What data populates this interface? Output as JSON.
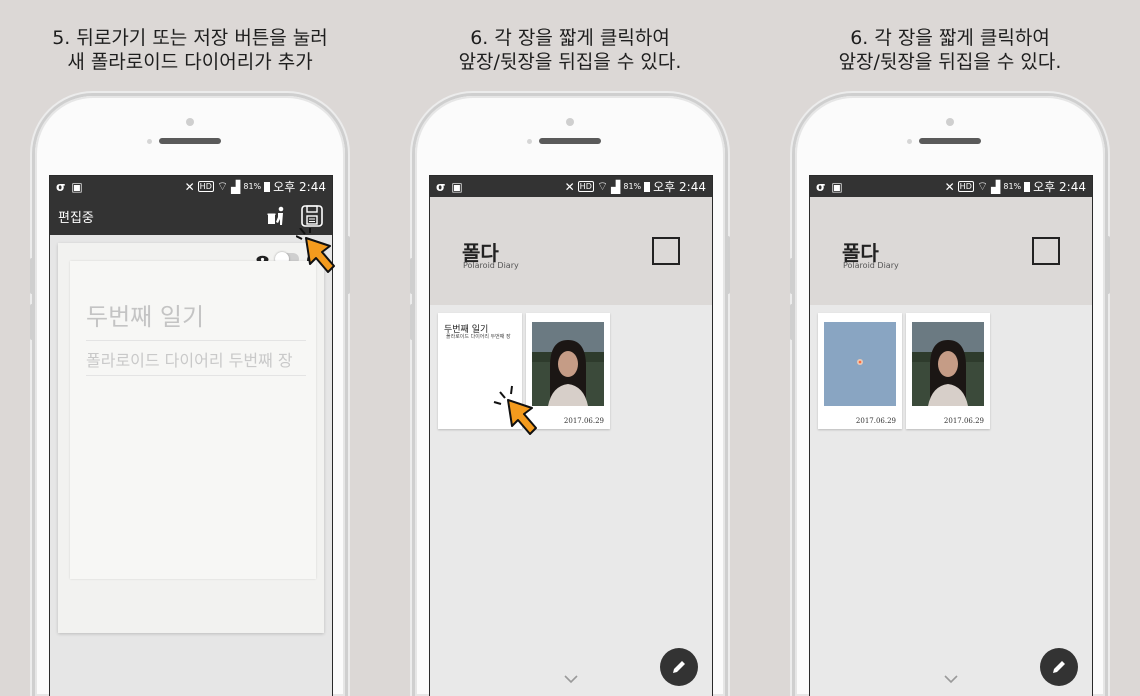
{
  "panels": [
    {
      "caption_line1": "5. 뒤로가기 또는 저장 버튼을 눌러",
      "caption_line2": "새 폴라로이드 다이어리가 추가",
      "status_time": "오후 2:44",
      "status_battery": "81%",
      "status_hd": "HD",
      "toolbar_title": "편집중",
      "note_title": "두번째 일기",
      "note_body": "폴라로이드 다이어리 두번째 장"
    },
    {
      "caption_line1": "6. 각 장을 짧게 클릭하여",
      "caption_line2": "앞장/뒷장을 뒤집을 수 있다.",
      "status_time": "오후 2:44",
      "status_battery": "81%",
      "status_hd": "HD",
      "app_title": "폴다",
      "app_subtitle": "Polaroid Diary",
      "card1_back_title": "두번째 일기",
      "card1_back_body": "폴라로이드 다이어리 두번째 장",
      "card2_date": "2017.06.29"
    },
    {
      "caption_line1": "6. 각 장을 짧게 클릭하여",
      "caption_line2": "앞장/뒷장을 뒤집을 수 있다.",
      "status_time": "오후 2:44",
      "status_battery": "81%",
      "status_hd": "HD",
      "app_title": "폴다",
      "app_subtitle": "Polaroid Diary",
      "card1_date": "2017.06.29",
      "card2_date": "2017.06.29"
    }
  ],
  "icons": {
    "statusbar_left": [
      "vee-app-icon",
      "image-icon"
    ],
    "statusbar_right": [
      "mute-icon",
      "hd-badge",
      "wifi-icon",
      "signal-icon",
      "battery-icon"
    ],
    "toolbar": [
      "delete-trash-icon",
      "save-floppy-icon"
    ],
    "note": [
      "eye-icon",
      "toggle-switch",
      "bell-icon"
    ],
    "fab": "pencil-icon",
    "bottom": "chevron-down-icon",
    "pointer": "cursor-arrow-icon"
  },
  "colors": {
    "background": "#dcd8d6",
    "statusbar": "#333333",
    "cursor": "#f49b1d",
    "header": "#dcd9d7"
  }
}
